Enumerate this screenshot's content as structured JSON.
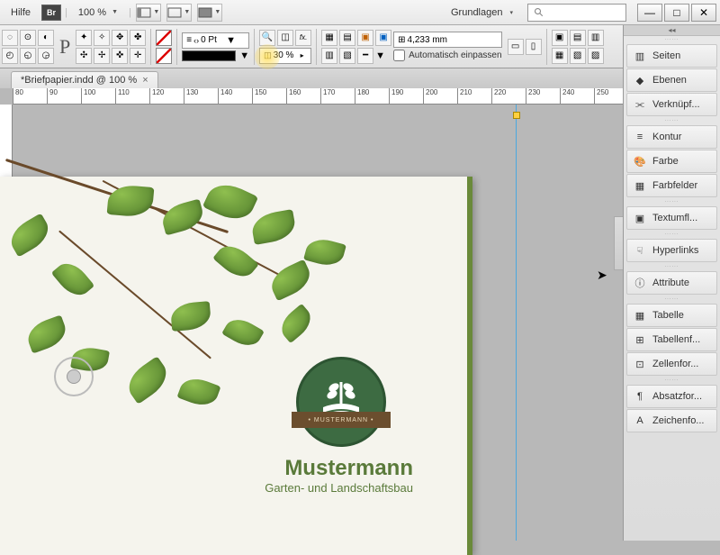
{
  "menubar": {
    "help": "Hilfe",
    "br": "Br",
    "zoom": "100 %",
    "workspace": "Grundlagen"
  },
  "toolbar": {
    "stroke_value": "0 Pt",
    "opacity_value": "30 %",
    "size_value": "4,233 mm",
    "autofit": "Automatisch einpassen"
  },
  "tab": {
    "title": "*Briefpapier.indd @ 100 %"
  },
  "ruler": {
    "marks": [
      "80",
      "90",
      "100",
      "110",
      "120",
      "130",
      "140",
      "150",
      "160",
      "170",
      "180",
      "190",
      "200",
      "210",
      "220",
      "230",
      "240",
      "250"
    ]
  },
  "document": {
    "company_name": "Mustermann",
    "company_sub": "Garten- und Landschaftsbau",
    "banner": "• MUSTERMANN •"
  },
  "panels": [
    {
      "icon": "pages",
      "label": "Seiten"
    },
    {
      "icon": "layers",
      "label": "Ebenen"
    },
    {
      "icon": "links",
      "label": "Verknüpf..."
    },
    {
      "gap": true
    },
    {
      "icon": "stroke",
      "label": "Kontur"
    },
    {
      "icon": "color",
      "label": "Farbe"
    },
    {
      "icon": "swatches",
      "label": "Farbfelder"
    },
    {
      "gap": true
    },
    {
      "icon": "textwrap",
      "label": "Textumfl..."
    },
    {
      "gap": true
    },
    {
      "icon": "hyperlinks",
      "label": "Hyperlinks"
    },
    {
      "gap": true
    },
    {
      "icon": "attributes",
      "label": "Attribute"
    },
    {
      "gap": true
    },
    {
      "icon": "table",
      "label": "Tabelle"
    },
    {
      "icon": "tableformat",
      "label": "Tabellenf..."
    },
    {
      "icon": "cellformat",
      "label": "Zellenfor..."
    },
    {
      "gap": true
    },
    {
      "icon": "paraformat",
      "label": "Absatzfor..."
    },
    {
      "icon": "charformat",
      "label": "Zeichenfo..."
    }
  ]
}
